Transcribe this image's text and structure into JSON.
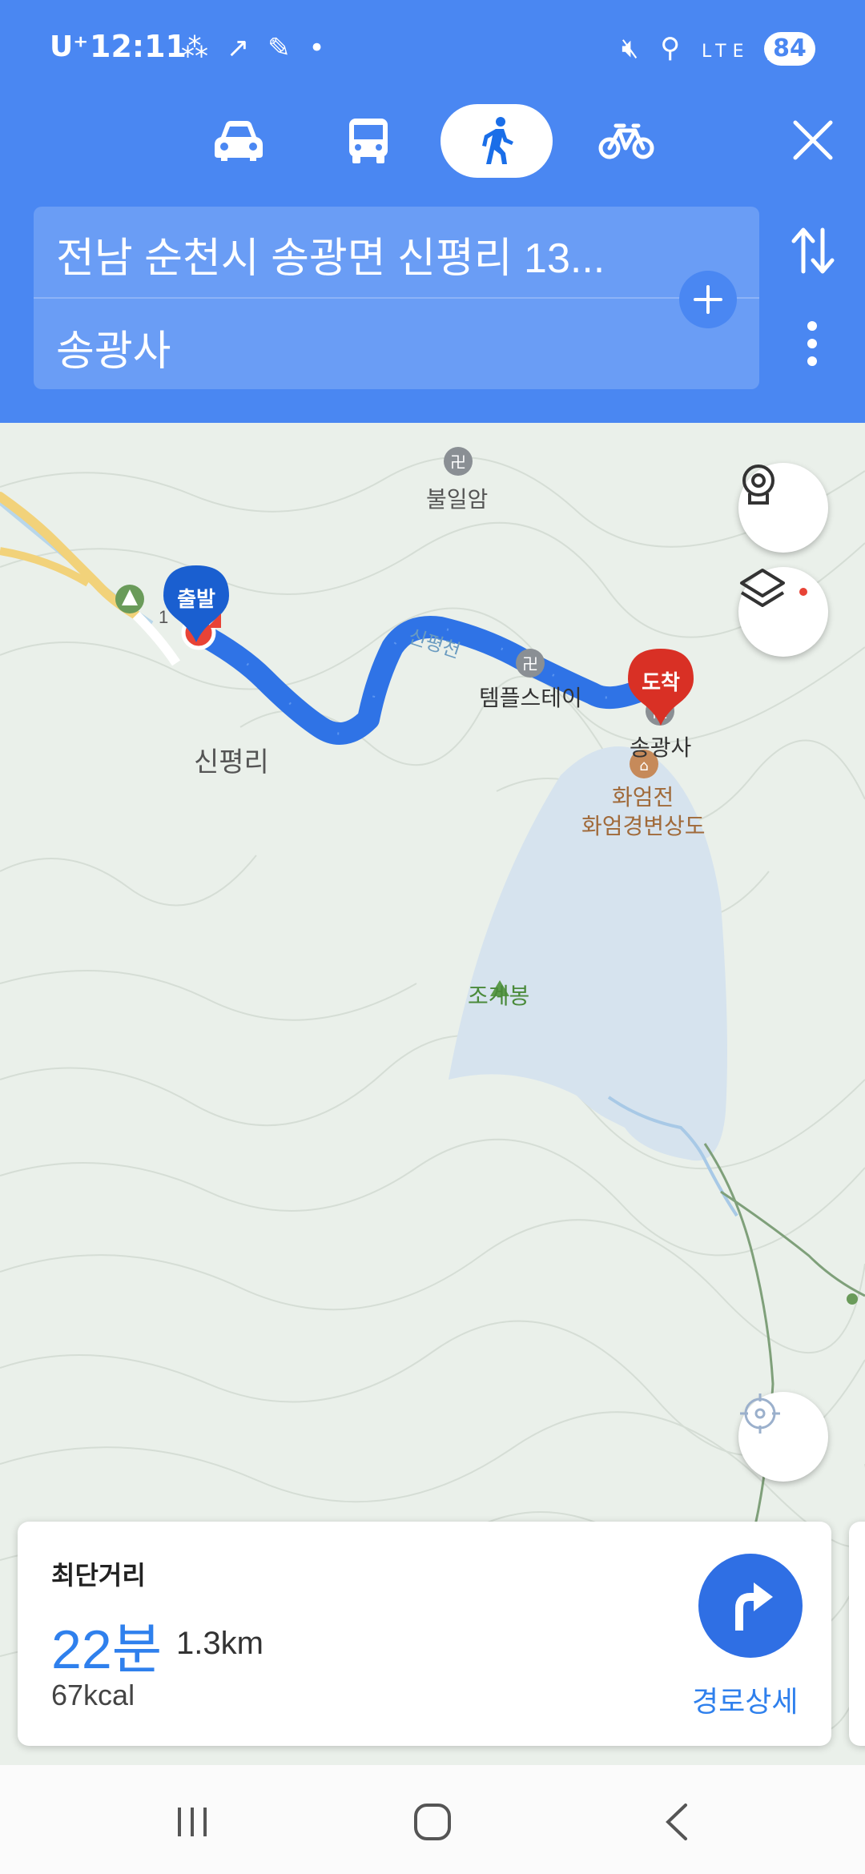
{
  "status_bar": {
    "carrier": "U⁺",
    "time": "12:11",
    "left_icons": [
      "grid-icon",
      "wifi-call-icon",
      "feather-icon",
      "dot-icon"
    ],
    "right_icons": [
      "mute-icon",
      "location-icon",
      "lte-icon",
      "signal-icon"
    ],
    "battery": "84"
  },
  "transport_modes": [
    {
      "name": "car",
      "icon": "car-icon",
      "active": false
    },
    {
      "name": "transit",
      "icon": "bus-icon",
      "active": false
    },
    {
      "name": "walk",
      "icon": "walk-icon",
      "active": true
    },
    {
      "name": "bike",
      "icon": "bike-icon",
      "active": false
    }
  ],
  "route": {
    "origin": "전남 순천시 송광면 신평리 13...",
    "destination": "송광사"
  },
  "map": {
    "labels": {
      "bulilam": "불일암",
      "sinpyeongri": "신평리",
      "templestay": "템플스테이",
      "songgwangsa": "송광사",
      "hwaeomjeon": "화엄전",
      "hwaeom_painting": "화엄경변상도",
      "jogyebong": "조계봉",
      "stream": "신평천",
      "road_number": "1"
    },
    "start_pin": "출발",
    "end_pin": "도착",
    "colors": {
      "route": "#2f73e6",
      "start_pin": "#1a5fd0",
      "end_pin": "#d93025",
      "water": "#d6e3ee",
      "road": "#f2d27a"
    }
  },
  "route_card": {
    "title": "최단거리",
    "time": "22분",
    "distance": "1.3km",
    "calories": "67kcal",
    "detail_label": "경로상세"
  }
}
